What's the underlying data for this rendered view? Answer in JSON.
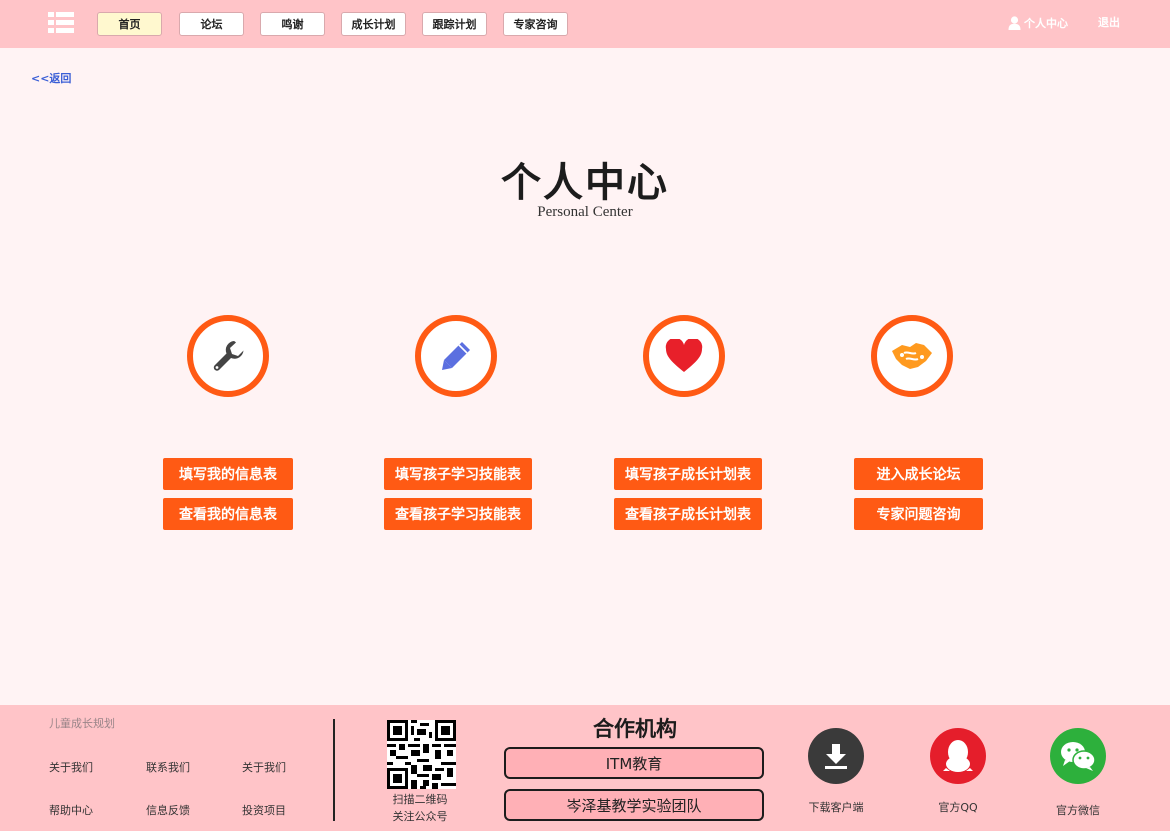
{
  "header": {
    "nav": [
      "首页",
      "论坛",
      "鸣谢",
      "成长计划",
      "跟踪计划",
      "专家咨询"
    ],
    "user_center": "个人中心",
    "logout": "退出"
  },
  "back": "<<返回",
  "title": "个人中心",
  "subtitle": "Personal Center",
  "features": [
    {
      "icon": "wrench-icon",
      "buttons": [
        "填写我的信息表",
        "查看我的信息表"
      ]
    },
    {
      "icon": "pencil-icon",
      "buttons": [
        "填写孩子学习技能表",
        "查看孩子学习技能表"
      ]
    },
    {
      "icon": "heart-icon",
      "buttons": [
        "填写孩子成长计划表",
        "查看孩子成长计划表"
      ]
    },
    {
      "icon": "handshake-icon",
      "buttons": [
        "进入成长论坛",
        "专家问题咨询"
      ]
    }
  ],
  "footer": {
    "brand": "儿童成长规划",
    "links": [
      [
        "关于我们",
        "联系我们",
        "关于我们"
      ],
      [
        "帮助中心",
        "信息反馈",
        "投资项目"
      ]
    ],
    "qr_caption": [
      "扫描二维码",
      "关注公众号"
    ],
    "partners_title": "合作机构",
    "partners": [
      "ITM教育",
      "岑泽基教学实验团队"
    ],
    "apps": [
      "下载客户端",
      "官方QQ",
      "官方微信"
    ]
  },
  "colors": {
    "header_bg": "#ffc4c8",
    "accent": "#ff5a14",
    "page_bg": "#fff3f4",
    "active_nav": "#fff8cf"
  }
}
